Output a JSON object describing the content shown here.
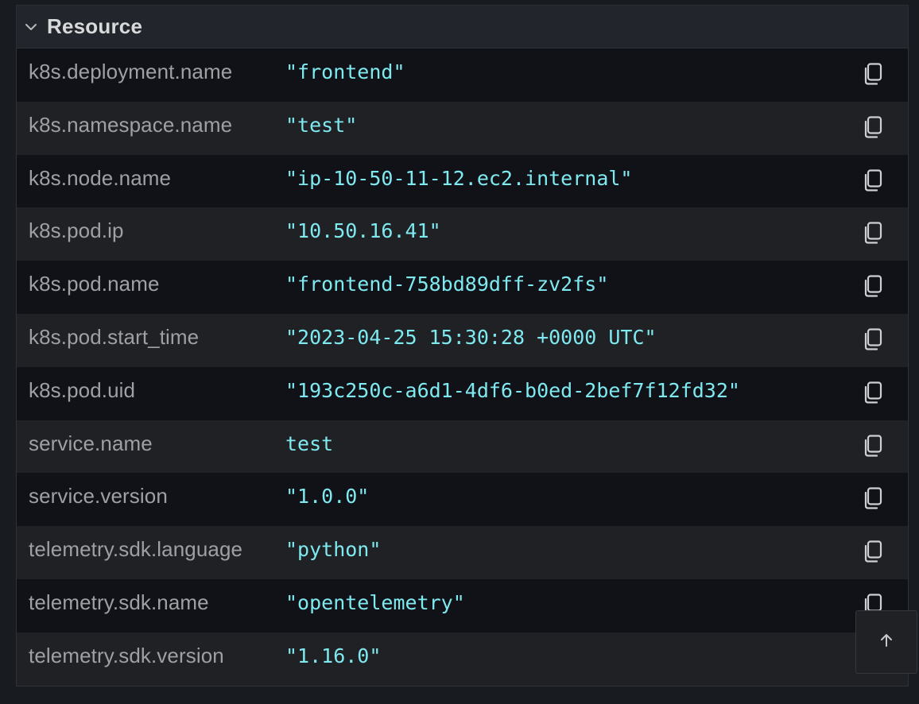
{
  "section": {
    "title": "Resource"
  },
  "attributes": [
    {
      "key": "k8s.deployment.name",
      "value": "\"frontend\""
    },
    {
      "key": "k8s.namespace.name",
      "value": "\"test\""
    },
    {
      "key": "k8s.node.name",
      "value": "\"ip-10-50-11-12.ec2.internal\""
    },
    {
      "key": "k8s.pod.ip",
      "value": "\"10.50.16.41\""
    },
    {
      "key": "k8s.pod.name",
      "value": "\"frontend-758bd89dff-zv2fs\""
    },
    {
      "key": "k8s.pod.start_time",
      "value": "\"2023-04-25 15:30:28 +0000 UTC\""
    },
    {
      "key": "k8s.pod.uid",
      "value": "\"193c250c-a6d1-4df6-b0ed-2bef7f12fd32\""
    },
    {
      "key": "service.name",
      "value": "test"
    },
    {
      "key": "service.version",
      "value": "\"1.0.0\""
    },
    {
      "key": "telemetry.sdk.language",
      "value": "\"python\""
    },
    {
      "key": "telemetry.sdk.name",
      "value": "\"opentelemetry\""
    },
    {
      "key": "telemetry.sdk.version",
      "value": "\"1.16.0\""
    }
  ],
  "icons": {
    "chevron": "chevron-down-icon",
    "copy": "copy-icon",
    "scroll_top": "arrow-up-icon"
  },
  "colors": {
    "key_text": "#9fa0a4",
    "value_text": "#7fe9f0",
    "title_text": "#d8d9da"
  }
}
